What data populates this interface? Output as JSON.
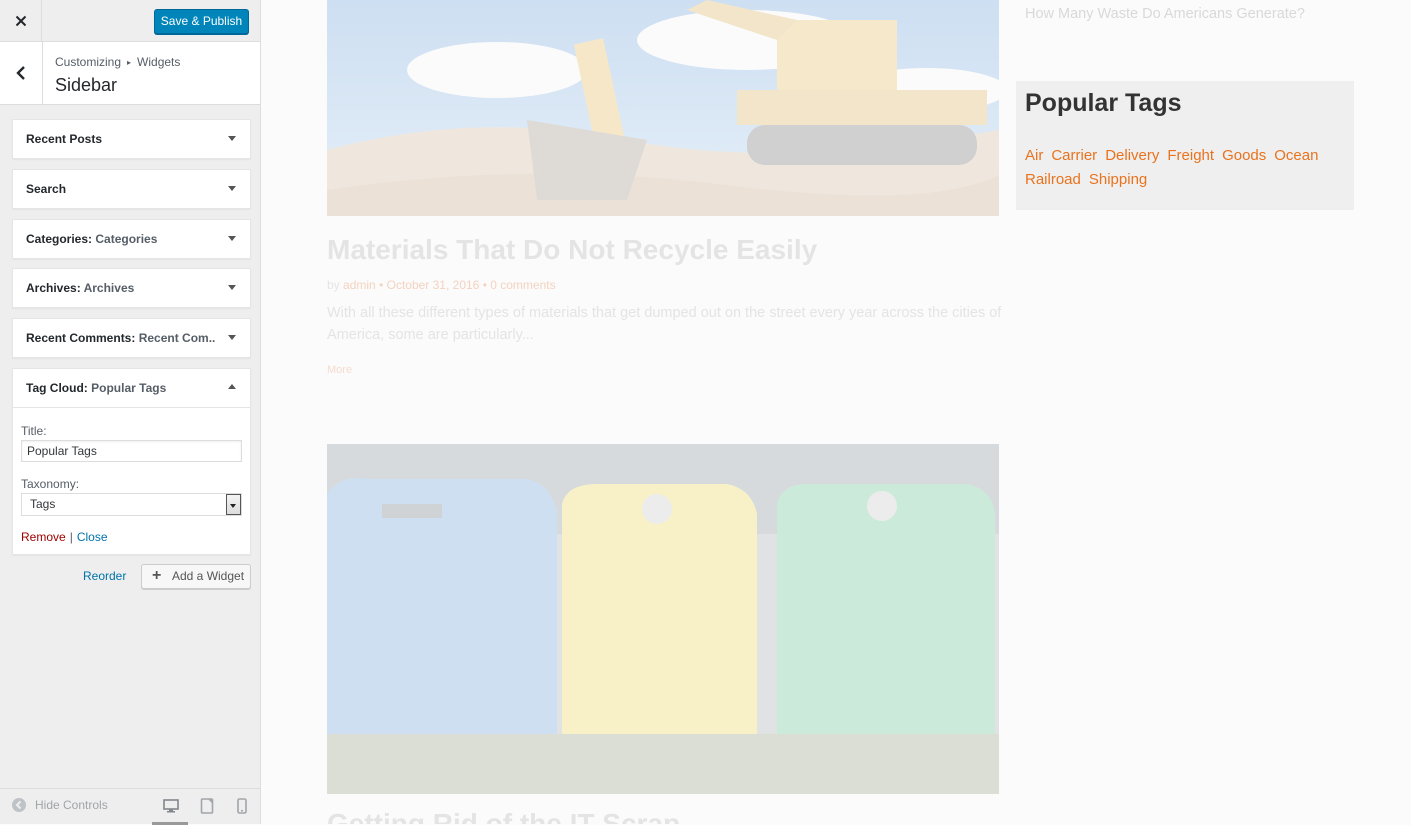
{
  "customizer": {
    "close_icon": "close-icon",
    "save_label": "Save & Publish",
    "breadcrumb": {
      "root": "Customizing",
      "section": "Widgets"
    },
    "section_title": "Sidebar",
    "widgets": [
      {
        "name": "Recent Posts",
        "subtitle": ""
      },
      {
        "name": "Search",
        "subtitle": ""
      },
      {
        "name": "Categories",
        "subtitle": "Categories"
      },
      {
        "name": "Archives",
        "subtitle": "Archives"
      },
      {
        "name": "Recent Comments",
        "subtitle": "Recent Com..."
      },
      {
        "name": "Tag Cloud",
        "subtitle": "Popular Tags"
      }
    ],
    "tag_cloud_form": {
      "title_label": "Title:",
      "title_value": "Popular Tags",
      "taxonomy_label": "Taxonomy:",
      "taxonomy_value": "Tags",
      "remove_label": "Remove",
      "separator": "|",
      "close_label": "Close"
    },
    "reorder_label": "Reorder",
    "add_widget_label": "Add a Widget",
    "hide_controls_label": "Hide Controls",
    "colors": {
      "primary": "#0085ba",
      "link": "#0073aa",
      "remove": "#a00000"
    }
  },
  "preview": {
    "recent_post_link": "How Many Waste Do Americans Generate?",
    "post1": {
      "title": "Materials That Do Not Recycle Easily",
      "by": "by",
      "author": "admin",
      "bullet": "•",
      "date": "October 31, 2016",
      "comments": "0 comments",
      "excerpt": "With all these different types of materials that get dumped out on the street every year across the cities of America, some are particularly...",
      "more": "More"
    },
    "post2": {
      "title": "Getting Rid of the IT Scrap"
    },
    "tag_widget": {
      "title": "Popular Tags",
      "tags": [
        "Air",
        "Carrier",
        "Delivery",
        "Freight",
        "Goods",
        "Ocean",
        "Railroad",
        "Shipping"
      ]
    },
    "colors": {
      "tag": "#e8731f"
    }
  }
}
